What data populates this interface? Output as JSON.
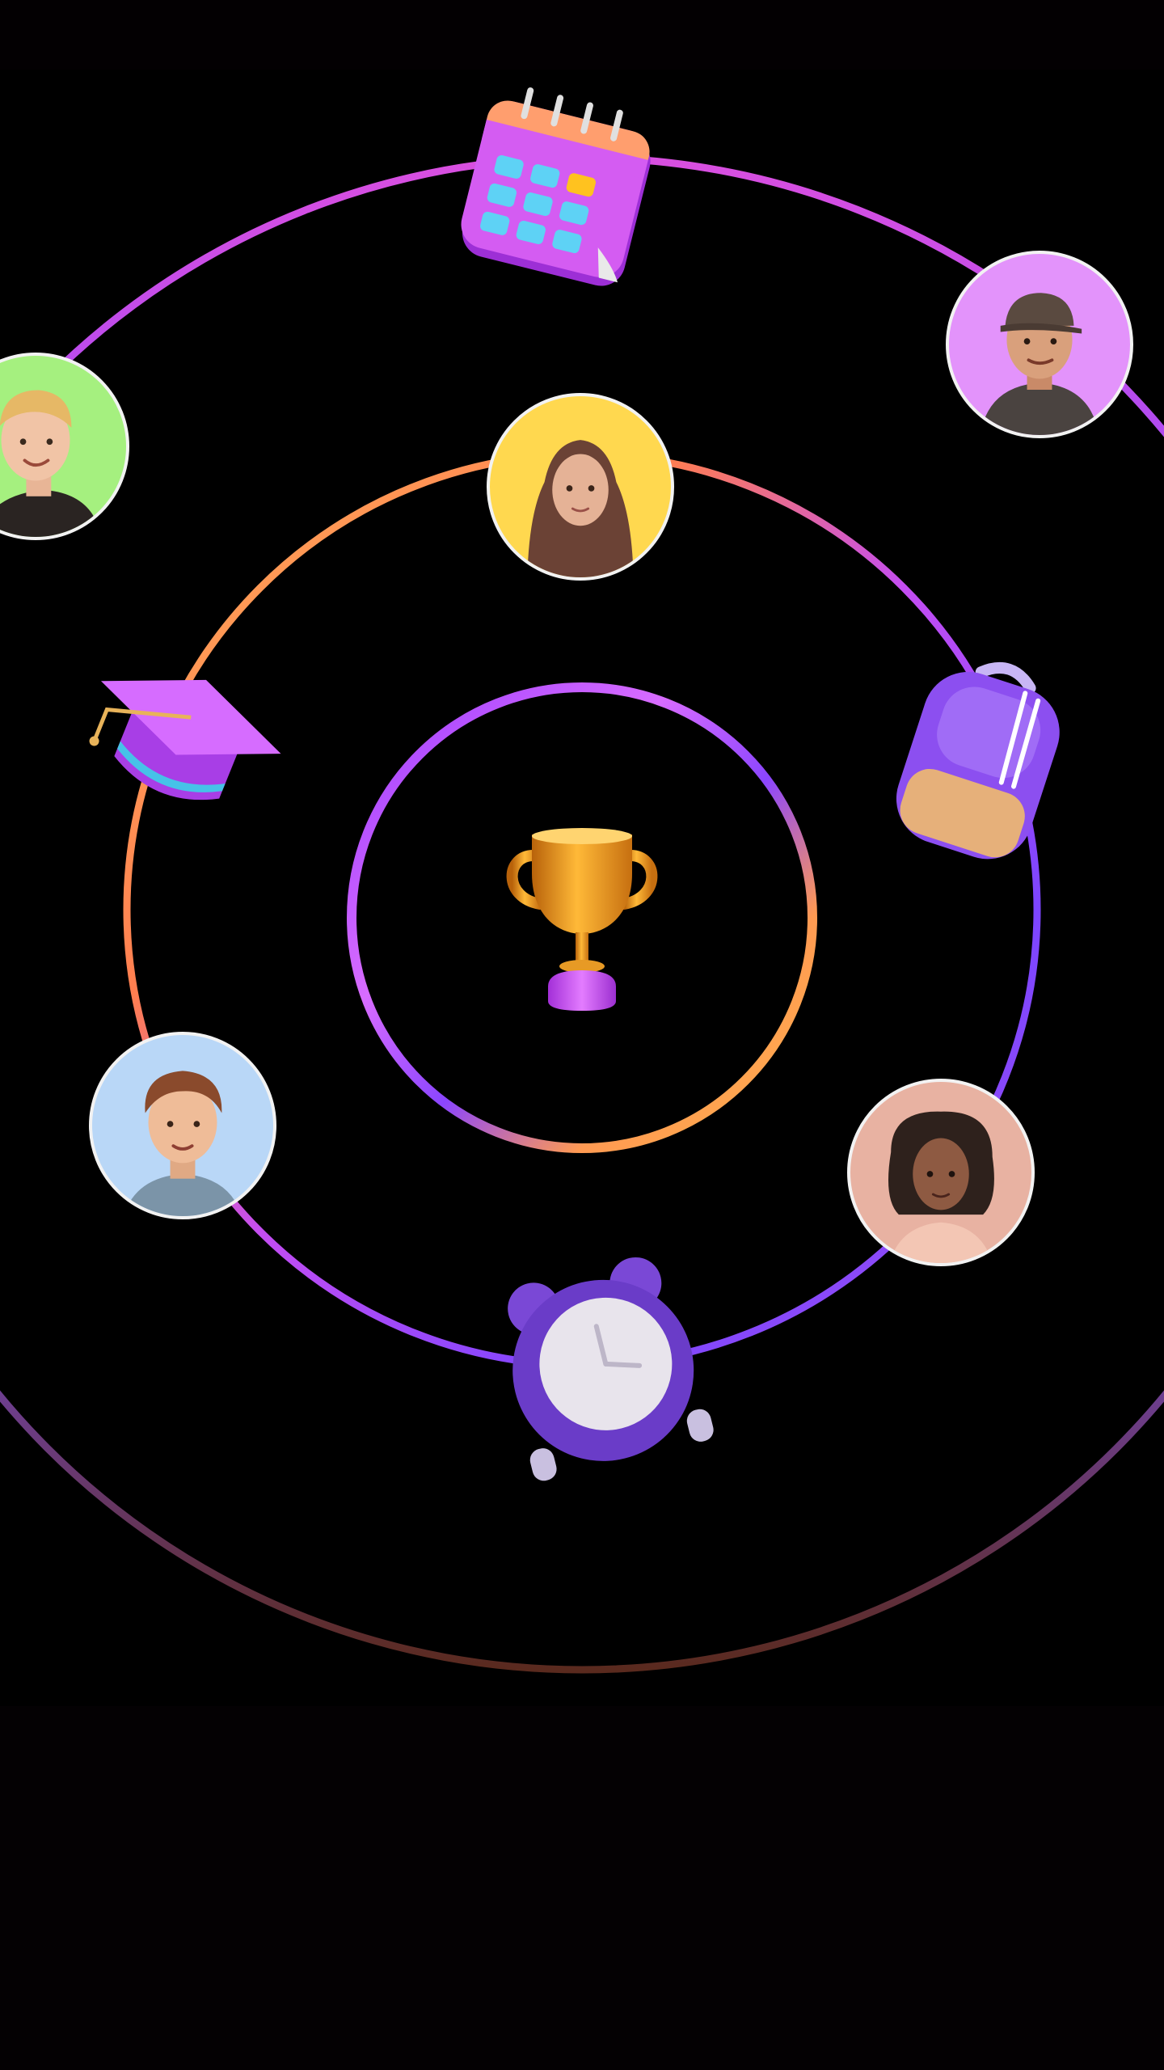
{
  "scene": {
    "name": "orbit-illustration",
    "background": "#000000",
    "accent_colors": {
      "orbit_purple": "#8b45ff",
      "orbit_pink": "#e65ad7",
      "orbit_orange": "#ff8a4c",
      "orbit_yellow": "#ffc866",
      "orbit_brown": "#7a3f2a"
    }
  },
  "center": {
    "icon": "trophy-icon"
  },
  "orbits": [
    {
      "name": "inner",
      "items": []
    },
    {
      "name": "middle",
      "items": [
        {
          "icon": "avatar-hijab-icon",
          "color": "#ffd84f"
        },
        {
          "icon": "backpack-icon",
          "color": "#8a4cf0"
        },
        {
          "icon": "avatar-curly-hair-icon",
          "color": "#e8b2a2"
        },
        {
          "icon": "alarm-clock-icon",
          "color": "#6a3cc8"
        },
        {
          "icon": "avatar-young-man-icon",
          "color": "#b9d7f7"
        },
        {
          "icon": "graduation-cap-icon",
          "color": "#c14df2"
        }
      ]
    },
    {
      "name": "outer",
      "items": [
        {
          "icon": "calendar-icon",
          "color": "#c43be8"
        },
        {
          "icon": "avatar-cap-man-icon",
          "color": "#e393fb"
        },
        {
          "icon": "avatar-blond-man-icon",
          "color": "#a5f07f"
        }
      ]
    }
  ]
}
